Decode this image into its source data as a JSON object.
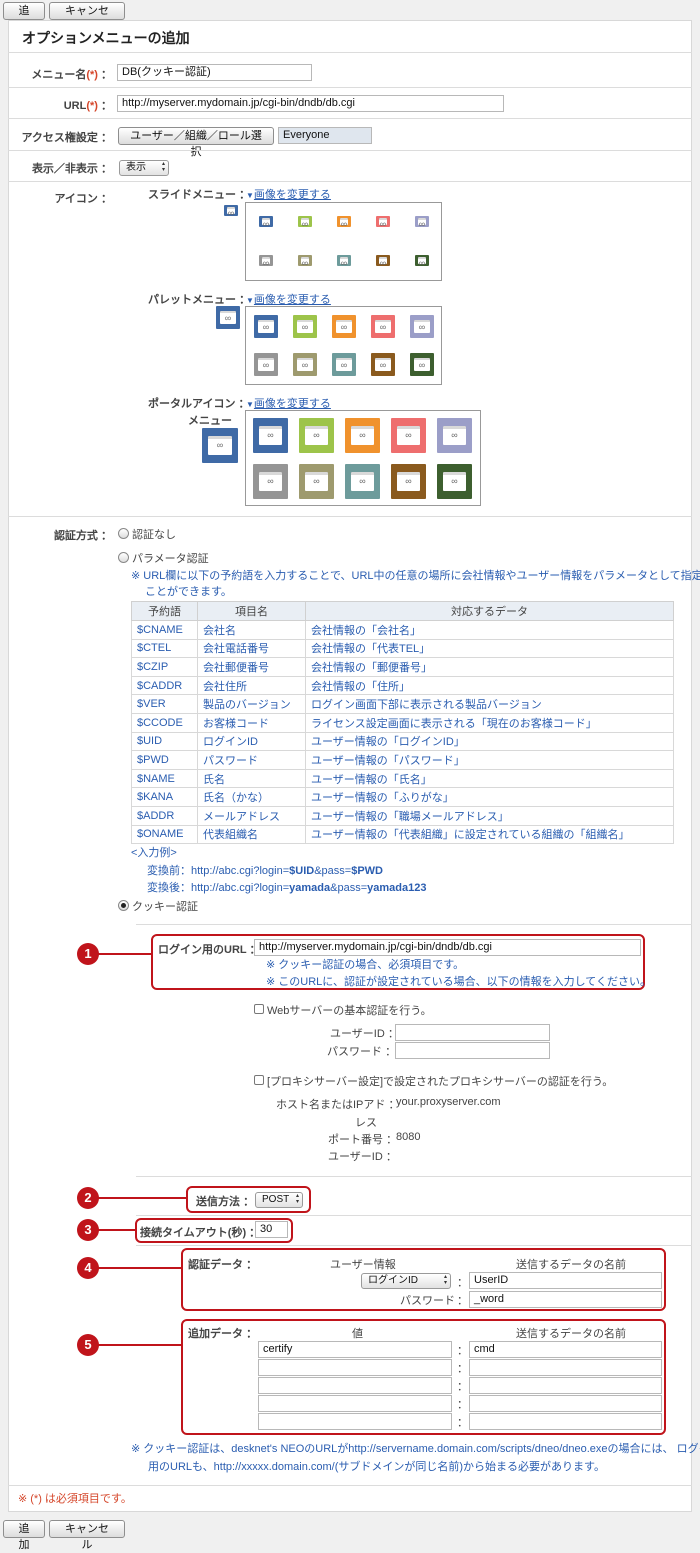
{
  "toolbar": {
    "add": "追加",
    "cancel": "キャンセル"
  },
  "page_title": "オプションメニューの追加",
  "form": {
    "menu_name_label": "メニュー名",
    "required_mark": "(*)",
    "colon": "：",
    "menu_name_value": "DB(クッキー認証)",
    "url_label": "URL",
    "url_value": "http://myserver.mydomain.jp/cgi-bin/dndb/db.cgi",
    "access_label": "アクセス権設定",
    "access_button": "ユーザー／組織／ロール選択",
    "access_value": "Everyone",
    "visibility_label": "表示／非表示",
    "visibility_value": "表示",
    "icon_label": "アイコン",
    "slide_menu_label": "スライドメニュー",
    "palette_menu_label": "パレットメニュー",
    "portal_icon_label": "ポータルアイコン",
    "portal_icon_sub": "メニュー",
    "change_image": "画像を変更する"
  },
  "icon_colors": [
    "#3f6aa6",
    "#9dc44a",
    "#f0922d",
    "#ee6e6e",
    "#9b9ec8",
    "#959595",
    "#9e9a6e",
    "#6d9b9b",
    "#8a5a1e",
    "#3d5f2f"
  ],
  "auth": {
    "label": "認証方式",
    "none": "認証なし",
    "param": "パラメータ認証",
    "param_note_1": "※ URL欄に以下の予約語を入力することで、URL中の任意の場所に会社情報やユーザー情報をパラメータとして指定する",
    "param_note_2": "ことができます。",
    "table_headers": [
      "予約語",
      "項目名",
      "対応するデータ"
    ],
    "table_rows": [
      [
        "$CNAME",
        "会社名",
        "会社情報の「会社名」"
      ],
      [
        "$CTEL",
        "会社電話番号",
        "会社情報の「代表TEL」"
      ],
      [
        "$CZIP",
        "会社郵便番号",
        "会社情報の「郵便番号」"
      ],
      [
        "$CADDR",
        "会社住所",
        "会社情報の「住所」"
      ],
      [
        "$VER",
        "製品のバージョン",
        "ログイン画面下部に表示される製品バージョン"
      ],
      [
        "$CCODE",
        "お客様コード",
        "ライセンス設定画面に表示される「現在のお客様コード」"
      ],
      [
        "$UID",
        "ログインID",
        "ユーザー情報の「ログインID」"
      ],
      [
        "$PWD",
        "パスワード",
        "ユーザー情報の「パスワード」"
      ],
      [
        "$NAME",
        "氏名",
        "ユーザー情報の「氏名」"
      ],
      [
        "$KANA",
        "氏名（かな）",
        "ユーザー情報の「ふりがな」"
      ],
      [
        "$ADDR",
        "メールアドレス",
        "ユーザー情報の「職場メールアドレス」"
      ],
      [
        "$ONAME",
        "代表組織名",
        "ユーザー情報の「代表組織」に設定されている組織の「組織名」"
      ]
    ],
    "example_label": "<入力例>",
    "example_before_prefix": "変換前：http://abc.cgi?login=",
    "example_before_uid": "$UID",
    "example_before_mid": "&pass=",
    "example_before_pwd": "$PWD",
    "example_after_prefix": "変換後：http://abc.cgi?login=",
    "example_after_uid": "yamada",
    "example_after_mid": "&pass=",
    "example_after_pwd": "yamada123",
    "cookie": "クッキー認証"
  },
  "cookie": {
    "login_url_label": "ログイン用のURL",
    "login_url_value": "http://myserver.mydomain.jp/cgi-bin/dndb/db.cgi",
    "login_note_1": "※ クッキー認証の場合、必須項目です。",
    "login_note_2": "※ このURLに、認証が設定されている場合、以下の情報を入力してください。",
    "basic_auth": "Webサーバーの基本認証を行う。",
    "user_id_label": "ユーザーID",
    "password_label": "パスワード",
    "proxy_auth": "[プロキシサーバー設定]で設定されたプロキシサーバーの認証を行う。",
    "host_label_1": "ホスト名またはIPアド",
    "host_label_2": "レス",
    "host_value": "your.proxyserver.com",
    "port_label": "ポート番号",
    "port_value": "8080",
    "proxy_user_label": "ユーザーID",
    "send_method_label": "送信方法",
    "send_method_value": "POST",
    "timeout_label": "接続タイムアウト(秒)",
    "timeout_value": "30",
    "auth_data_label": "認証データ",
    "user_info_header": "ユーザー情報",
    "send_name_header": "送信するデータの名前",
    "login_id_select": "ログインID",
    "auth_user_value": "UserID",
    "auth_pw_label": "パスワード",
    "auth_pw_value": "_word",
    "extra_data_label": "追加データ",
    "value_header": "値",
    "extra_send_header": "送信するデータの名前",
    "extra_rows": [
      [
        "certify",
        "cmd"
      ],
      [
        "",
        ""
      ],
      [
        "",
        ""
      ],
      [
        "",
        ""
      ],
      [
        "",
        ""
      ]
    ],
    "footer_note_1": "※ クッキー認証は、desknet's NEOのURLがhttp://servername.domain.com/scripts/dneo/dneo.exeの場合には、 ログイン",
    "footer_note_2": "用のURLも、http://xxxxx.domain.com/(サブドメインが同じ名前)から始まる必要があります。"
  },
  "required_note": "※ (*) は必須項目です。",
  "markers": [
    "1",
    "2",
    "3",
    "4",
    "5"
  ]
}
